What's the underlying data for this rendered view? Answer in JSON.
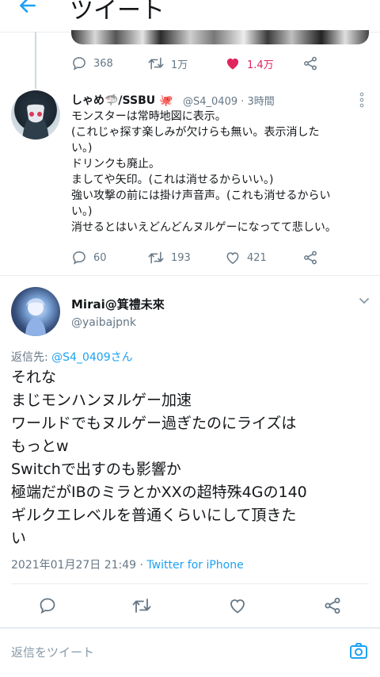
{
  "header": {
    "title": "ツイート"
  },
  "prev_tweet": {
    "actions": {
      "replies": "368",
      "retweets": "1万",
      "likes": "1.4万"
    }
  },
  "tweet1": {
    "name": "しゃめ🦈/SSBU 🐙",
    "handle": "@S4_0409",
    "separator": "·",
    "time": "3時間",
    "lines": [
      "モンスターは常時地図に表示。",
      "(これじゃ探す楽しみが欠けらも無い。表示消した",
      "い。)",
      "ドリンクも廃止。",
      "ましてや矢印。(これは消せるからいい。)",
      "強い攻撃の前には掛け声音声。(これも消せるからい",
      "い。)",
      "消せるとはいえどんどんヌルゲーになってて悲しい。"
    ],
    "actions": {
      "replies": "60",
      "retweets": "193",
      "likes": "421"
    }
  },
  "tweet2": {
    "name": "Mirai@箕禮未來",
    "handle": "@yaibajpnk",
    "reply_prefix": "返信先: ",
    "reply_to": "@S4_0409さん",
    "lines": [
      "それな",
      "まじモンハンヌルゲー加速",
      "ワールドでもヌルゲー過ぎたのにライズは",
      "もっとw",
      "Switchで出すのも影響か",
      "極端だがIBのミラとかXXの超特殊4Gの140",
      "ギルクエレベルを普通くらいにして頂きた",
      "い"
    ],
    "timestamp": "2021年01月27日 21:49 · ",
    "source": "Twitter for iPhone"
  },
  "reply_bar": {
    "placeholder": "返信をツイート"
  },
  "colors": {
    "accent": "#1da1f2",
    "like": "#e0245e",
    "muted": "#657786"
  }
}
